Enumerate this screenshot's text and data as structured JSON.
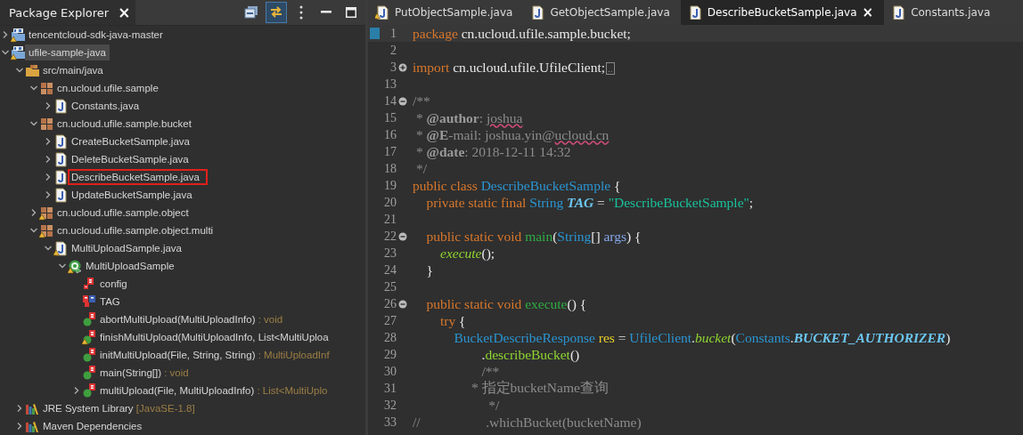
{
  "explorer": {
    "title": "Package Explorer",
    "close": "×",
    "toolbar": [
      {
        "kind": "collapse",
        "on": false
      },
      {
        "kind": "link",
        "on": true
      },
      {
        "kind": "menu",
        "on": false
      },
      {
        "kind": "minimize",
        "on": false
      },
      {
        "kind": "maximize",
        "on": false
      }
    ],
    "tree": [
      {
        "label": "tencentcloud-sdk-java-master",
        "kind": "project",
        "warning": true,
        "expanded": false,
        "selected": false
      },
      {
        "label": "ufile-sample-java",
        "kind": "project",
        "warning": true,
        "expanded": true,
        "selected": true,
        "children": [
          {
            "label": "src/main/java",
            "kind": "srcfolder",
            "expanded": true,
            "selected": false,
            "children": [
              {
                "label": "cn.ucloud.ufile.sample",
                "kind": "package",
                "expanded": true,
                "selected": false,
                "children": [
                  {
                    "label": "Constants.java",
                    "kind": "java",
                    "expanded": false,
                    "selected": false
                  }
                ]
              },
              {
                "label": "cn.ucloud.ufile.sample.bucket",
                "kind": "package",
                "expanded": true,
                "selected": false,
                "children": [
                  {
                    "label": "CreateBucketSample.java",
                    "kind": "java",
                    "expanded": false,
                    "selected": false
                  },
                  {
                    "label": "DeleteBucketSample.java",
                    "kind": "java",
                    "expanded": false,
                    "selected": false
                  },
                  {
                    "label": "DescribeBucketSample.java",
                    "kind": "java",
                    "expanded": false,
                    "selected": false,
                    "highlighted": true
                  },
                  {
                    "label": "UpdateBucketSample.java",
                    "kind": "java",
                    "expanded": false,
                    "selected": false
                  }
                ]
              },
              {
                "label": "cn.ucloud.ufile.sample.object",
                "kind": "package",
                "warning": true,
                "expanded": false,
                "selected": false
              },
              {
                "label": "cn.ucloud.ufile.sample.object.multi",
                "kind": "package",
                "warning": true,
                "expanded": true,
                "selected": false,
                "children": [
                  {
                    "label": "MultiUploadSample.java",
                    "kind": "java",
                    "warning": true,
                    "expanded": true,
                    "selected": false,
                    "children": [
                      {
                        "label": "MultiUploadSample",
                        "kind": "class",
                        "warning": true,
                        "expanded": true,
                        "selected": false,
                        "children": [
                          {
                            "label": "config",
                            "kind": "field",
                            "selected": false
                          },
                          {
                            "label": "TAG",
                            "kind": "constant",
                            "selected": false
                          },
                          {
                            "label": "abortMultiUpload(MultiUploadInfo)",
                            "detail": " : void",
                            "kind": "method",
                            "selected": false
                          },
                          {
                            "label": "finishMultiUpload(MultiUploadInfo, List<MultiUploa",
                            "kind": "method",
                            "warning": true,
                            "selected": false
                          },
                          {
                            "label": "initMultiUpload(File, String, String)",
                            "detail": " : MultiUploadInf",
                            "kind": "method",
                            "selected": false
                          },
                          {
                            "label": "main(String[])",
                            "detail": " : void",
                            "kind": "method",
                            "selected": false
                          },
                          {
                            "label": "multiUpload(File, MultiUploadInfo)",
                            "detail": " : List<MultiUplo",
                            "kind": "method",
                            "expanded": false,
                            "selected": false
                          }
                        ]
                      }
                    ]
                  }
                ]
              }
            ]
          },
          {
            "label": "JRE System Library",
            "detail": " [JavaSE-1.8]",
            "kind": "library",
            "expanded": false,
            "selected": false
          },
          {
            "label": "Maven Dependencies",
            "kind": "library",
            "expanded": false,
            "selected": false
          }
        ]
      }
    ]
  },
  "editor": {
    "tabs": [
      {
        "label": "PutObjectSample.java",
        "warning": true,
        "selected": false
      },
      {
        "label": "GetObjectSample.java",
        "warning": false,
        "selected": false
      },
      {
        "label": "DescribeBucketSample.java",
        "warning": false,
        "selected": true,
        "close": "×"
      },
      {
        "label": "Constants.java",
        "warning": false,
        "selected": false
      }
    ],
    "lines": [
      {
        "n": "1",
        "current": true,
        "tokens": [
          {
            "text": "package ",
            "kind": "keyword"
          },
          {
            "text": "cn.ucloud.ufile.sample.bucket;",
            "kind": "plain"
          }
        ]
      },
      {
        "n": "2",
        "current": false
      },
      {
        "n": "3",
        "current": false,
        "expanded": false,
        "tokens": [
          {
            "text": "import ",
            "kind": "keyword"
          },
          {
            "text": "cn.ucloud.ufile.UfileClient;",
            "kind": "plain"
          },
          {
            "text": "..",
            "kind": "box"
          }
        ]
      },
      {
        "n": "13",
        "current": false
      },
      {
        "n": "14",
        "current": false,
        "expanded": true,
        "tokens": [
          {
            "text": "/**",
            "kind": "comment"
          }
        ]
      },
      {
        "n": "15",
        "current": false,
        "tokens": [
          {
            "text": " * ",
            "kind": "comment"
          },
          {
            "text": "@author",
            "kind": "tag"
          },
          {
            "text": ": ",
            "kind": "comment"
          },
          {
            "text": "joshua",
            "kind": "typo"
          }
        ]
      },
      {
        "n": "16",
        "current": false,
        "tokens": [
          {
            "text": " * ",
            "kind": "comment"
          },
          {
            "text": "@E",
            "kind": "tag"
          },
          {
            "text": "-mail: joshua.yin@",
            "kind": "comment"
          },
          {
            "text": "ucloud.cn",
            "kind": "typo"
          }
        ]
      },
      {
        "n": "17",
        "current": false,
        "tokens": [
          {
            "text": " * ",
            "kind": "comment"
          },
          {
            "text": "@date",
            "kind": "tag"
          },
          {
            "text": ": 2018-12-11 14:32",
            "kind": "comment"
          }
        ]
      },
      {
        "n": "18",
        "current": false,
        "tokens": [
          {
            "text": " */",
            "kind": "comment"
          }
        ]
      },
      {
        "n": "19",
        "current": false,
        "tokens": [
          {
            "text": "public class ",
            "kind": "keyword"
          },
          {
            "text": "DescribeBucketSample",
            "kind": "type"
          },
          {
            "text": " {",
            "kind": "plain"
          }
        ]
      },
      {
        "n": "20",
        "current": false,
        "tokens": [
          {
            "text": "    private static final ",
            "kind": "keyword"
          },
          {
            "text": "String ",
            "kind": "type"
          },
          {
            "text": "TAG",
            "kind": "constant"
          },
          {
            "text": " = ",
            "kind": "plain"
          },
          {
            "text": "\"DescribeBucketSample\"",
            "kind": "string"
          },
          {
            "text": ";",
            "kind": "plain"
          }
        ]
      },
      {
        "n": "21",
        "current": false
      },
      {
        "n": "22",
        "current": false,
        "expanded": true,
        "tokens": [
          {
            "text": "    public static void ",
            "kind": "keyword"
          },
          {
            "text": "main",
            "kind": "declaration"
          },
          {
            "text": "(",
            "kind": "plain"
          },
          {
            "text": "String",
            "kind": "type"
          },
          {
            "text": "[] ",
            "kind": "plain"
          },
          {
            "text": "args",
            "kind": "parameter"
          },
          {
            "text": ") {",
            "kind": "plain"
          }
        ]
      },
      {
        "n": "23",
        "current": false,
        "tokens": [
          {
            "text": "        execute",
            "kind": "staticcall"
          },
          {
            "text": "();",
            "kind": "plain"
          }
        ]
      },
      {
        "n": "24",
        "current": false,
        "tokens": [
          {
            "text": "    }",
            "kind": "plain"
          }
        ]
      },
      {
        "n": "25",
        "current": false
      },
      {
        "n": "26",
        "current": false,
        "expanded": true,
        "tokens": [
          {
            "text": "    public static void ",
            "kind": "keyword"
          },
          {
            "text": "execute",
            "kind": "declaration"
          },
          {
            "text": "() {",
            "kind": "plain"
          }
        ]
      },
      {
        "n": "27",
        "current": false,
        "tokens": [
          {
            "text": "        try",
            "kind": "keyword"
          },
          {
            "text": " {",
            "kind": "plain"
          }
        ]
      },
      {
        "n": "28",
        "current": false,
        "tokens": [
          {
            "text": "            BucketDescribeResponse ",
            "kind": "type"
          },
          {
            "text": "res",
            "kind": "local"
          },
          {
            "text": " = ",
            "kind": "plain"
          },
          {
            "text": "UfileClient",
            "kind": "type"
          },
          {
            "text": ".",
            "kind": "plain"
          },
          {
            "text": "bucket",
            "kind": "staticcall"
          },
          {
            "text": "(",
            "kind": "plain"
          },
          {
            "text": "Constants",
            "kind": "type"
          },
          {
            "text": ".",
            "kind": "plain"
          },
          {
            "text": "BUCKET_AUTHORIZER",
            "kind": "constant"
          },
          {
            "text": ")",
            "kind": "plain"
          }
        ]
      },
      {
        "n": "29",
        "current": false,
        "tokens": [
          {
            "text": "                    .",
            "kind": "plain"
          },
          {
            "text": "describeBucket",
            "kind": "call"
          },
          {
            "text": "()",
            "kind": "plain"
          }
        ]
      },
      {
        "n": "30",
        "current": false,
        "tokens": [
          {
            "text": "                    /**",
            "kind": "comment"
          }
        ]
      },
      {
        "n": "31",
        "current": false,
        "tokens": [
          {
            "text": "                 * 指定bucketName查询",
            "kind": "comment"
          }
        ]
      },
      {
        "n": "32",
        "current": false,
        "tokens": [
          {
            "text": "                      */",
            "kind": "comment"
          }
        ]
      },
      {
        "n": "33",
        "current": false,
        "tokens": [
          {
            "text": "//                   .whichBucket(bucketName)",
            "kind": "comment"
          }
        ]
      }
    ]
  }
}
